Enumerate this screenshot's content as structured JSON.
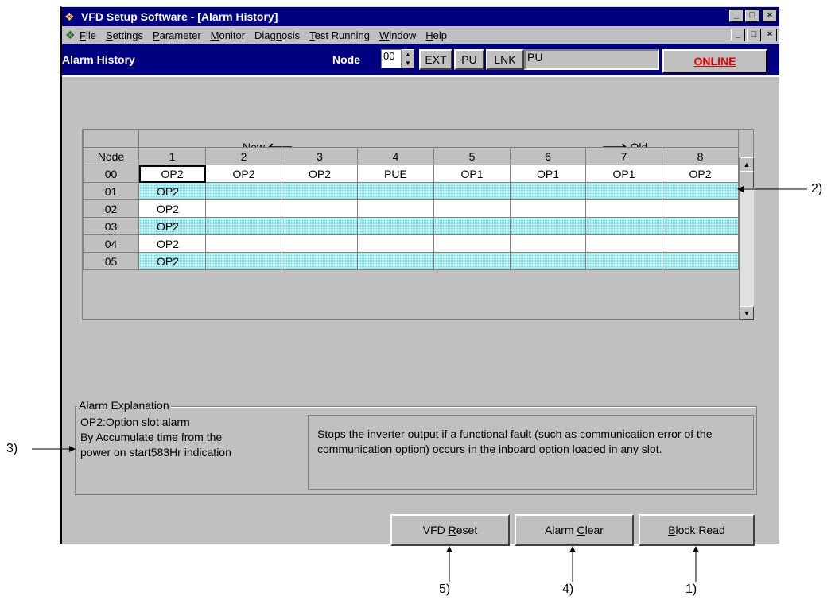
{
  "window": {
    "title": "VFD Setup Software - [Alarm History]",
    "min_glyph": "_",
    "max_glyph": "□",
    "close_glyph": "×"
  },
  "menu": {
    "items": [
      {
        "pre": "",
        "key": "F",
        "post": "ile"
      },
      {
        "pre": "",
        "key": "S",
        "post": "ettings"
      },
      {
        "pre": "",
        "key": "P",
        "post": "arameter"
      },
      {
        "pre": "",
        "key": "M",
        "post": "onitor"
      },
      {
        "pre": "Diag",
        "key": "n",
        "post": "osis"
      },
      {
        "pre": "",
        "key": "T",
        "post": "est Running"
      },
      {
        "pre": "",
        "key": "W",
        "post": "indow"
      },
      {
        "pre": "",
        "key": "H",
        "post": "elp"
      }
    ]
  },
  "toolbar": {
    "screen_name": "Alarm History",
    "node_label": "Node",
    "node_value": "00",
    "ext_label": "EXT",
    "pu_label": "PU",
    "lnk_label": "LNK",
    "mode_value": "PU",
    "online_label": "ONLINE"
  },
  "grid": {
    "new_label": "New",
    "old_label": "Old",
    "node_header": "Node",
    "columns": [
      "1",
      "2",
      "3",
      "4",
      "5",
      "6",
      "7",
      "8"
    ],
    "rows": [
      {
        "node": "00",
        "cells": [
          "OP2",
          "OP2",
          "OP2",
          "PUE",
          "OP1",
          "OP1",
          "OP1",
          "OP2"
        ]
      },
      {
        "node": "01",
        "cells": [
          "OP2",
          "",
          "",
          "",
          "",
          "",
          "",
          ""
        ]
      },
      {
        "node": "02",
        "cells": [
          "OP2",
          "",
          "",
          "",
          "",
          "",
          "",
          ""
        ]
      },
      {
        "node": "03",
        "cells": [
          "OP2",
          "",
          "",
          "",
          "",
          "",
          "",
          ""
        ]
      },
      {
        "node": "04",
        "cells": [
          "OP2",
          "",
          "",
          "",
          "",
          "",
          "",
          ""
        ]
      },
      {
        "node": "05",
        "cells": [
          "OP2",
          "",
          "",
          "",
          "",
          "",
          "",
          ""
        ]
      }
    ]
  },
  "explanation": {
    "title": "Alarm Explanation",
    "left_lines": [
      "OP2:Option slot alarm",
      "By Accumulate time from the",
      "power on start583Hr indication"
    ],
    "right_text": "Stops the inverter output if a functional fault (such as communication error of the communication option) occurs in the inboard option loaded in any slot."
  },
  "buttons": {
    "reset": {
      "pre": "VFD ",
      "key": "R",
      "post": "eset"
    },
    "clear": {
      "pre": "Alarm ",
      "key": "C",
      "post": "lear"
    },
    "block": {
      "pre": "",
      "key": "B",
      "post": "lock Read"
    }
  },
  "callouts": [
    "1)",
    "2)",
    "3)",
    "4)",
    "5)"
  ],
  "colors": {
    "title_bar": "#000080",
    "online_text": "#e00000",
    "alt_row": "#b8f0f4"
  }
}
